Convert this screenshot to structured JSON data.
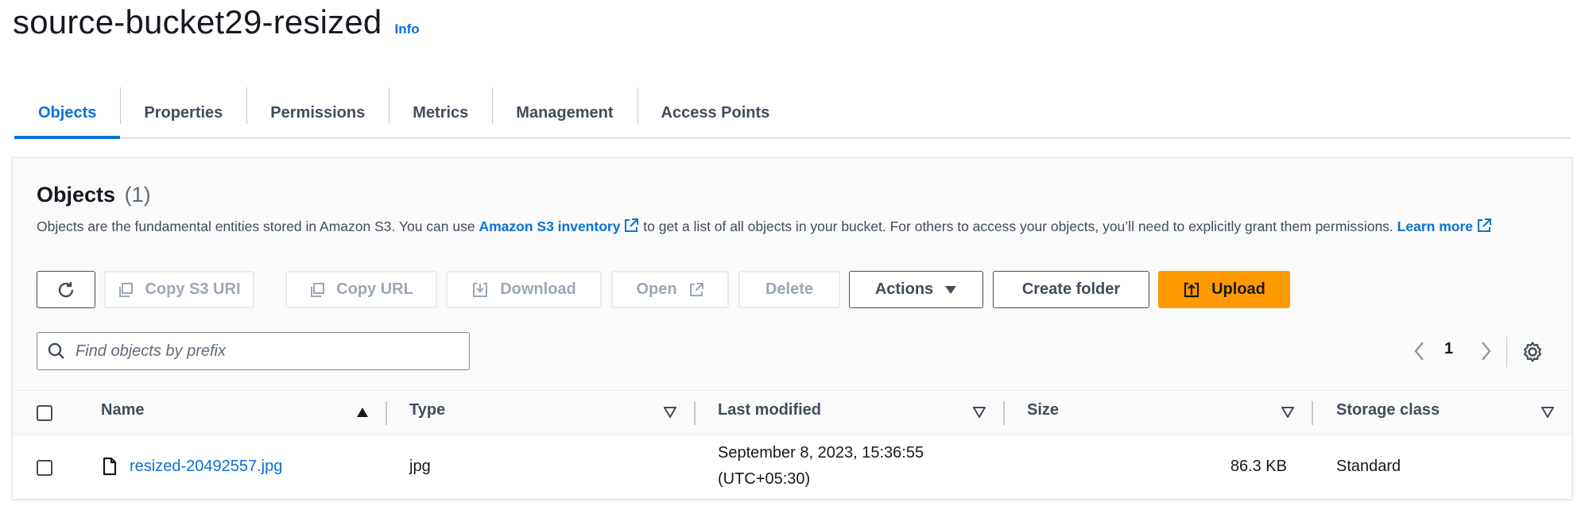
{
  "header": {
    "title": "source-bucket29-resized",
    "info_label": "Info"
  },
  "tabs": [
    {
      "label": "Objects",
      "active": true
    },
    {
      "label": "Properties"
    },
    {
      "label": "Permissions"
    },
    {
      "label": "Metrics"
    },
    {
      "label": "Management"
    },
    {
      "label": "Access Points"
    }
  ],
  "objects": {
    "heading": "Objects",
    "count": "(1)",
    "description_part1": "Objects are the fundamental entities stored in Amazon S3. You can use ",
    "inventory_link": "Amazon S3 inventory",
    "description_part2": " to get a list of all objects in your bucket. For others to access your objects, you’ll need to explicitly grant them permissions. ",
    "learn_more": "Learn more"
  },
  "toolbar": {
    "copy_s3_uri": "Copy S3 URI",
    "copy_url": "Copy URL",
    "download": "Download",
    "open": "Open",
    "delete": "Delete",
    "actions": "Actions",
    "create_folder": "Create folder",
    "upload": "Upload"
  },
  "search": {
    "placeholder": "Find objects by prefix",
    "value": ""
  },
  "pagination": {
    "current_page": "1"
  },
  "table": {
    "columns": [
      "Name",
      "Type",
      "Last modified",
      "Size",
      "Storage class"
    ],
    "rows": [
      {
        "name": "resized-20492557.jpg",
        "type": "jpg",
        "last_modified_line1": "September 8, 2023, 15:36:55",
        "last_modified_line2": "(UTC+05:30)",
        "size": "86.3 KB",
        "storage_class": "Standard"
      }
    ]
  },
  "colors": {
    "accent": "#0972d3",
    "primary_button": "#ff9900",
    "text": "#16191f",
    "muted": "#414d5c"
  },
  "icons": [
    "refresh-icon",
    "copy-icon",
    "download-icon",
    "external-link-icon",
    "caret-down-icon",
    "upload-icon",
    "search-icon",
    "chevron-left-icon",
    "chevron-right-icon",
    "settings-gear-icon",
    "sort-ascending-icon",
    "sort-descending-icon",
    "file-icon"
  ]
}
